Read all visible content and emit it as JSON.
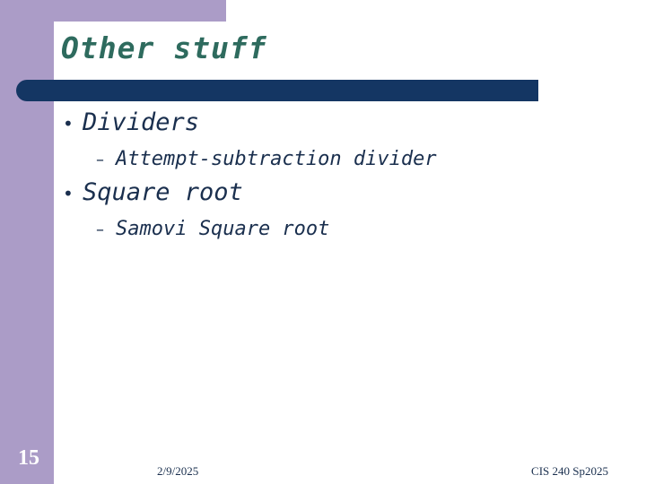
{
  "slide": {
    "title": "Other stuff",
    "bullets": [
      {
        "text": "Dividers",
        "sub": [
          "Attempt-subtraction divider"
        ]
      },
      {
        "text": "Square root",
        "sub": [
          "Samovi Square root"
        ]
      }
    ],
    "bullet_glyph": "•",
    "sub_glyph": "–",
    "slide_number": "15",
    "footer_date": "2/9/2025",
    "footer_course": "CIS 240 Sp2025"
  },
  "colors": {
    "frame_purple": "#ab9cc7",
    "title_green": "#2e6b5e",
    "rule_navy": "#143663",
    "text_navy": "#1a2f4e"
  }
}
